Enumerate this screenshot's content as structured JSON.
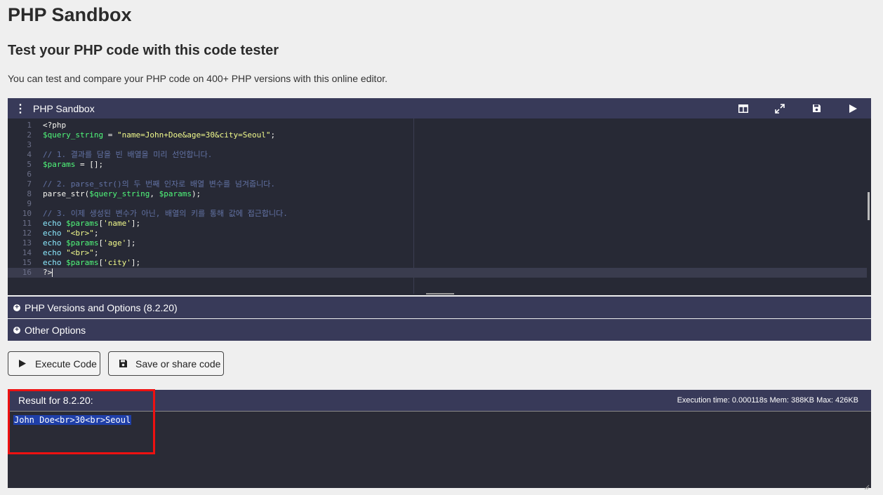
{
  "page": {
    "title": "PHP Sandbox",
    "subtitle": "Test your PHP code with this code tester",
    "intro": "You can test and compare your PHP code on 400+ PHP versions with this online editor."
  },
  "editor": {
    "header_title": "PHP Sandbox",
    "menu_icon": "⋮",
    "tools": [
      "split-view-icon",
      "fullscreen-icon",
      "save-icon",
      "run-icon"
    ],
    "lines": [
      {
        "n": "1",
        "tokens": [
          {
            "t": "<?php",
            "c": "tag"
          }
        ]
      },
      {
        "n": "2",
        "tokens": [
          {
            "t": "$query_string",
            "c": "var"
          },
          {
            "t": " = ",
            "c": "tag"
          },
          {
            "t": "\"name=John+Doe&age=30&city=Seoul\"",
            "c": "str"
          },
          {
            "t": ";",
            "c": "tag"
          }
        ]
      },
      {
        "n": "3",
        "tokens": []
      },
      {
        "n": "4",
        "tokens": [
          {
            "t": "// 1. 결과를 담을 빈 배열을 미리 선언합니다.",
            "c": "cmt"
          }
        ]
      },
      {
        "n": "5",
        "tokens": [
          {
            "t": "$params",
            "c": "var"
          },
          {
            "t": " = [];",
            "c": "tag"
          }
        ]
      },
      {
        "n": "6",
        "tokens": []
      },
      {
        "n": "7",
        "tokens": [
          {
            "t": "// 2. parse_str()의 두 번째 인자로 배열 변수를 넘겨줍니다.",
            "c": "cmt"
          }
        ]
      },
      {
        "n": "8",
        "tokens": [
          {
            "t": "parse_str(",
            "c": "tag"
          },
          {
            "t": "$query_string",
            "c": "var"
          },
          {
            "t": ", ",
            "c": "tag"
          },
          {
            "t": "$params",
            "c": "var"
          },
          {
            "t": ");",
            "c": "tag"
          }
        ]
      },
      {
        "n": "9",
        "tokens": []
      },
      {
        "n": "10",
        "tokens": [
          {
            "t": "// 3. 이제 생성된 변수가 아닌, 배열의 키를 통해 값에 접근합니다.",
            "c": "cmt"
          }
        ]
      },
      {
        "n": "11",
        "tokens": [
          {
            "t": "echo ",
            "c": "kw"
          },
          {
            "t": "$params",
            "c": "var"
          },
          {
            "t": "[",
            "c": "tag"
          },
          {
            "t": "'name'",
            "c": "str"
          },
          {
            "t": "];",
            "c": "tag"
          }
        ]
      },
      {
        "n": "12",
        "tokens": [
          {
            "t": "echo ",
            "c": "kw"
          },
          {
            "t": "\"<br>\"",
            "c": "str"
          },
          {
            "t": ";",
            "c": "tag"
          }
        ]
      },
      {
        "n": "13",
        "tokens": [
          {
            "t": "echo ",
            "c": "kw"
          },
          {
            "t": "$params",
            "c": "var"
          },
          {
            "t": "[",
            "c": "tag"
          },
          {
            "t": "'age'",
            "c": "str"
          },
          {
            "t": "];",
            "c": "tag"
          }
        ]
      },
      {
        "n": "14",
        "tokens": [
          {
            "t": "echo ",
            "c": "kw"
          },
          {
            "t": "\"<br>\"",
            "c": "str"
          },
          {
            "t": ";",
            "c": "tag"
          }
        ]
      },
      {
        "n": "15",
        "tokens": [
          {
            "t": "echo ",
            "c": "kw"
          },
          {
            "t": "$params",
            "c": "var"
          },
          {
            "t": "[",
            "c": "tag"
          },
          {
            "t": "'city'",
            "c": "str"
          },
          {
            "t": "];",
            "c": "tag"
          }
        ]
      },
      {
        "n": "16",
        "tokens": [
          {
            "t": "?>",
            "c": "tag"
          }
        ],
        "active": true
      }
    ]
  },
  "accordions": {
    "versions_label": "PHP Versions and Options (8.2.20)",
    "other_label": "Other Options"
  },
  "buttons": {
    "execute_label": "Execute Code",
    "save_label": "Save or share code"
  },
  "result": {
    "title": "Result for 8.2.20:",
    "exec_info": "Execution time: 0.000118s Mem: 388KB Max: 426KB",
    "output": "John Doe<br>30<br>Seoul"
  },
  "colors": {
    "header_bg": "#383a59",
    "editor_bg": "#272935",
    "highlight_border": "#ee1111",
    "selection_bg": "#1f3fa8"
  }
}
